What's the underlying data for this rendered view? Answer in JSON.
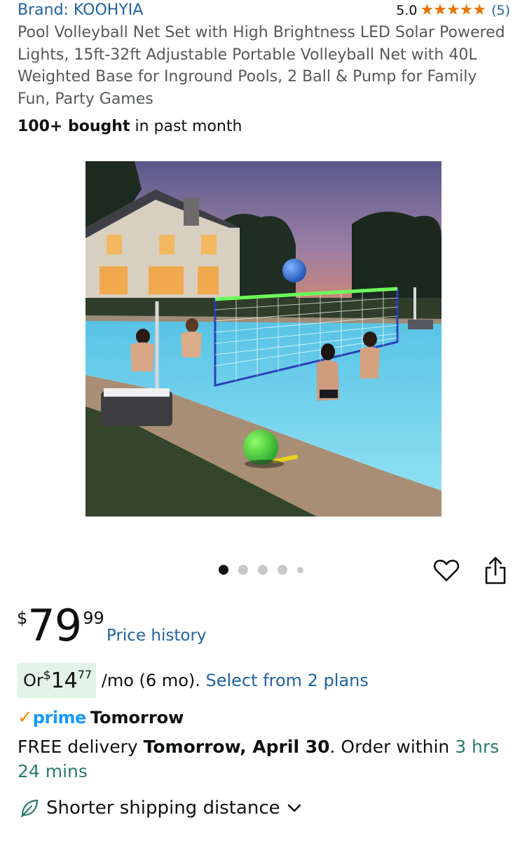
{
  "product": {
    "brand": "Brand: KOOHYIA",
    "rating_score": "5.0",
    "stars_icon": "★★★★★",
    "review_count": "(5)",
    "title": "Pool Volleyball Net Set with High Brightness LED Solar Powered Lights, 15ft-32ft Adjustable Portable Volleyball Net with 40L Weighted Base for Inground Pools, 2 Ball & Pump for Family Fun, Party Games",
    "bought_bold": "100+ bought",
    "bought_rest": " in past month",
    "image_count": 5,
    "active_image_index": 0
  },
  "price": {
    "currency": "$",
    "whole": "79",
    "fraction": "99",
    "history_link": "Price history"
  },
  "installment": {
    "prefix": "Or ",
    "currency": "$",
    "whole": "14",
    "fraction": "77",
    "suffix": " /mo (6 mo). ",
    "link": "Select from 2 plans"
  },
  "prime": {
    "check": "✓",
    "word": "prime",
    "when": "Tomorrow"
  },
  "delivery": {
    "free": "FREE delivery ",
    "date": "Tomorrow, April 30",
    "order_within": ". Order within ",
    "countdown": "3 hrs 24 mins"
  },
  "shipping": {
    "label": "Shorter shipping distance"
  },
  "colors": {
    "link": "#2162a1",
    "star": "#e77600",
    "prime_blue": "#1399ff",
    "countdown_green": "#2a7a6b",
    "installment_bg": "#e3f3e6"
  },
  "icons": [
    "heart-icon",
    "share-icon",
    "leaf-icon",
    "chevron-down-icon"
  ]
}
